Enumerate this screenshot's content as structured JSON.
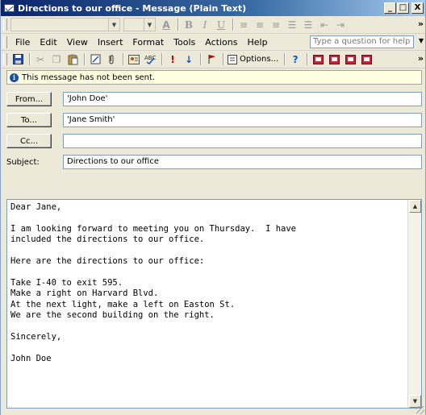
{
  "window": {
    "title": "Directions to our office - Message (Plain Text)"
  },
  "caption_buttons": {
    "minimize": "_",
    "maximize": "□",
    "close": "X"
  },
  "menu": {
    "items": [
      "File",
      "Edit",
      "View",
      "Insert",
      "Format",
      "Tools",
      "Actions",
      "Help"
    ],
    "help_placeholder": "Type a question for help"
  },
  "toolbar": {
    "options_label": "Options...",
    "overflow": "»"
  },
  "info": {
    "message": "This message has not been sent."
  },
  "address": {
    "from_label": "From...",
    "from_value": "'John Doe'",
    "to_label": "To...",
    "to_value": "'Jane Smith'",
    "cc_label": "Cc...",
    "cc_value": "",
    "subject_label": "Subject:",
    "subject_value": "Directions to our office"
  },
  "body": {
    "text": "Dear Jane,\n\nI am looking forward to meeting you on Thursday.  I have\nincluded the directions to our office.\n\nHere are the directions to our office:\n\nTake I-40 to exit 595.\nMake a right on Harvard Blvd.\nAt the next light, make a left on Easton St.\nWe are the second building on the right.\n\nSincerely,\n\nJohn Doe"
  },
  "colors": {
    "title_start": "#0a246a",
    "title_end": "#a6caf0",
    "info_bg": "#ffffe1"
  }
}
